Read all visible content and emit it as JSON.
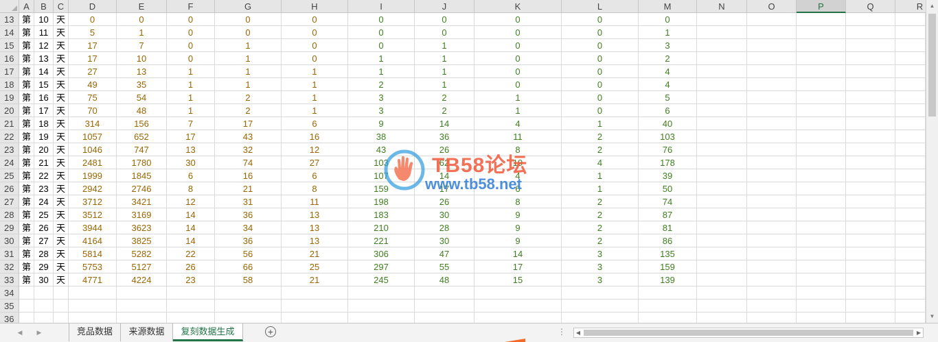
{
  "sheet": {
    "columns": [
      {
        "letter": "A",
        "type": "text"
      },
      {
        "letter": "B",
        "type": "text"
      },
      {
        "letter": "C",
        "type": "text"
      },
      {
        "letter": "D",
        "type": "orange"
      },
      {
        "letter": "E",
        "type": "orange"
      },
      {
        "letter": "F",
        "type": "orange"
      },
      {
        "letter": "G",
        "type": "orange"
      },
      {
        "letter": "H",
        "type": "orange"
      },
      {
        "letter": "I",
        "type": "green"
      },
      {
        "letter": "J",
        "type": "green"
      },
      {
        "letter": "K",
        "type": "green"
      },
      {
        "letter": "L",
        "type": "green"
      },
      {
        "letter": "M",
        "type": "green"
      },
      {
        "letter": "N",
        "type": "empty"
      },
      {
        "letter": "O",
        "type": "empty"
      },
      {
        "letter": "P",
        "type": "empty",
        "selected": true
      },
      {
        "letter": "Q",
        "type": "empty"
      },
      {
        "letter": "R",
        "type": "empty"
      }
    ],
    "rows": [
      {
        "n": "13",
        "cells": [
          "第",
          "10",
          "天",
          "0",
          "0",
          "0",
          "0",
          "0",
          "0",
          "0",
          "0",
          "0",
          "0"
        ]
      },
      {
        "n": "14",
        "cells": [
          "第",
          "11",
          "天",
          "5",
          "1",
          "0",
          "0",
          "0",
          "0",
          "0",
          "0",
          "0",
          "1"
        ]
      },
      {
        "n": "15",
        "cells": [
          "第",
          "12",
          "天",
          "17",
          "7",
          "0",
          "1",
          "0",
          "0",
          "1",
          "0",
          "0",
          "3"
        ]
      },
      {
        "n": "16",
        "cells": [
          "第",
          "13",
          "天",
          "17",
          "10",
          "0",
          "1",
          "0",
          "1",
          "1",
          "0",
          "0",
          "2"
        ]
      },
      {
        "n": "17",
        "cells": [
          "第",
          "14",
          "天",
          "27",
          "13",
          "1",
          "1",
          "1",
          "1",
          "1",
          "0",
          "0",
          "4"
        ]
      },
      {
        "n": "18",
        "cells": [
          "第",
          "15",
          "天",
          "49",
          "35",
          "1",
          "1",
          "1",
          "2",
          "1",
          "0",
          "0",
          "4"
        ]
      },
      {
        "n": "19",
        "cells": [
          "第",
          "16",
          "天",
          "75",
          "54",
          "1",
          "2",
          "1",
          "3",
          "2",
          "1",
          "0",
          "5"
        ]
      },
      {
        "n": "20",
        "cells": [
          "第",
          "17",
          "天",
          "70",
          "48",
          "1",
          "2",
          "1",
          "3",
          "2",
          "1",
          "0",
          "6"
        ]
      },
      {
        "n": "21",
        "cells": [
          "第",
          "18",
          "天",
          "314",
          "156",
          "7",
          "17",
          "6",
          "9",
          "14",
          "4",
          "1",
          "40"
        ]
      },
      {
        "n": "22",
        "cells": [
          "第",
          "19",
          "天",
          "1057",
          "652",
          "17",
          "43",
          "16",
          "38",
          "36",
          "11",
          "2",
          "103"
        ]
      },
      {
        "n": "23",
        "cells": [
          "第",
          "20",
          "天",
          "1046",
          "747",
          "13",
          "32",
          "12",
          "43",
          "26",
          "8",
          "2",
          "76"
        ]
      },
      {
        "n": "24",
        "cells": [
          "第",
          "21",
          "天",
          "2481",
          "1780",
          "30",
          "74",
          "27",
          "103",
          "62",
          "19",
          "4",
          "178"
        ]
      },
      {
        "n": "25",
        "cells": [
          "第",
          "22",
          "天",
          "1999",
          "1845",
          "6",
          "16",
          "6",
          "107",
          "14",
          "4",
          "1",
          "39"
        ]
      },
      {
        "n": "26",
        "cells": [
          "第",
          "23",
          "天",
          "2942",
          "2746",
          "8",
          "21",
          "8",
          "159",
          "17",
          "6",
          "1",
          "50"
        ]
      },
      {
        "n": "27",
        "cells": [
          "第",
          "24",
          "天",
          "3712",
          "3421",
          "12",
          "31",
          "11",
          "198",
          "26",
          "8",
          "2",
          "74"
        ]
      },
      {
        "n": "28",
        "cells": [
          "第",
          "25",
          "天",
          "3512",
          "3169",
          "14",
          "36",
          "13",
          "183",
          "30",
          "9",
          "2",
          "87"
        ]
      },
      {
        "n": "29",
        "cells": [
          "第",
          "26",
          "天",
          "3944",
          "3623",
          "14",
          "34",
          "13",
          "210",
          "28",
          "9",
          "2",
          "81"
        ]
      },
      {
        "n": "30",
        "cells": [
          "第",
          "27",
          "天",
          "4164",
          "3825",
          "14",
          "36",
          "13",
          "221",
          "30",
          "9",
          "2",
          "86"
        ]
      },
      {
        "n": "31",
        "cells": [
          "第",
          "28",
          "天",
          "5814",
          "5282",
          "22",
          "56",
          "21",
          "306",
          "47",
          "14",
          "3",
          "135"
        ]
      },
      {
        "n": "32",
        "cells": [
          "第",
          "29",
          "天",
          "5753",
          "5127",
          "26",
          "66",
          "25",
          "297",
          "55",
          "17",
          "3",
          "159"
        ]
      },
      {
        "n": "33",
        "cells": [
          "第",
          "30",
          "天",
          "4771",
          "4224",
          "23",
          "58",
          "21",
          "245",
          "48",
          "15",
          "3",
          "139"
        ]
      },
      {
        "n": "34",
        "cells": []
      },
      {
        "n": "35",
        "cells": []
      },
      {
        "n": "36",
        "cells": []
      }
    ]
  },
  "tabs": [
    {
      "label": "竞品数据",
      "active": false
    },
    {
      "label": "来源数据",
      "active": false
    },
    {
      "label": "复刻数据生成",
      "active": true
    }
  ],
  "tabbar": {
    "add_symbol": "+",
    "dots": "⋮",
    "nav_prev": "◀",
    "nav_next": "▶"
  },
  "watermark": {
    "line1": "TB58论坛",
    "line2": "www.tb58.net"
  },
  "colors": {
    "accent": "#217346",
    "orange_values": "#9c6500",
    "green_values": "#3f7f1f"
  }
}
